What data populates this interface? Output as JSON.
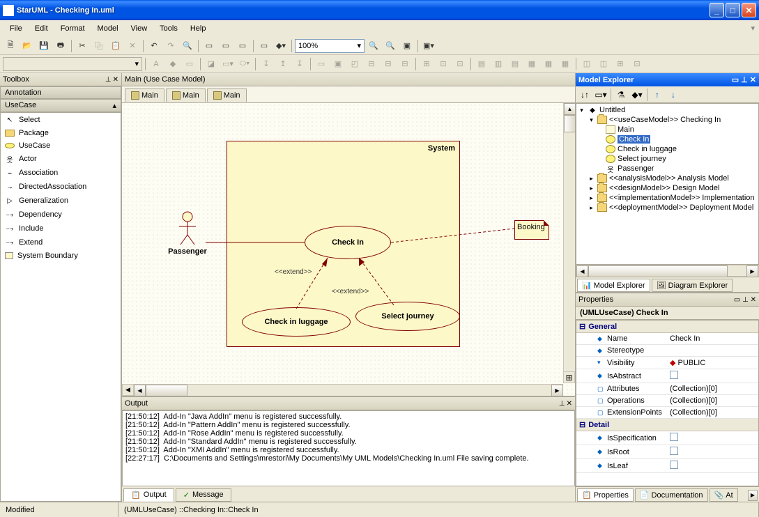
{
  "window": {
    "title": "StarUML - Checking In.uml"
  },
  "menu": [
    "File",
    "Edit",
    "Format",
    "Model",
    "View",
    "Tools",
    "Help"
  ],
  "zoom": "100%",
  "toolbox": {
    "title": "Toolbox",
    "section1": "Annotation",
    "section2": "UseCase",
    "items": [
      "Select",
      "Package",
      "UseCase",
      "Actor",
      "Association",
      "DirectedAssociation",
      "Generalization",
      "Dependency",
      "Include",
      "Extend",
      "System Boundary"
    ]
  },
  "diagram": {
    "header": "Main (Use Case Model)",
    "tabs": [
      "Main",
      "Main",
      "Main"
    ],
    "system_label": "System",
    "actor_label": "Passenger",
    "uc_checkin": "Check In",
    "uc_luggage": "Check in luggage",
    "uc_journey": "Select journey",
    "note": "Booking",
    "extend1": "<<extend>>",
    "extend2": "<<extend>>"
  },
  "output": {
    "title": "Output",
    "lines": "[21:50:12]  Add-In \"Java AddIn\" menu is registered successfully.\n[21:50:12]  Add-In \"Pattern AddIn\" menu is registered successfully.\n[21:50:12]  Add-In \"Rose AddIn\" menu is registered successfully.\n[21:50:12]  Add-In \"Standard AddIn\" menu is registered successfully.\n[21:50:12]  Add-In \"XMI AddIn\" menu is registered successfully.\n[22:27:17]  C:\\Documents and Settings\\mrestori\\My Documents\\My UML Models\\Checking In.uml File saving complete.",
    "tabs": [
      "Output",
      "Message"
    ]
  },
  "explorer": {
    "title": "Model Explorer",
    "root": "Untitled",
    "nodes": {
      "usecase_model": "<<useCaseModel>> Checking In",
      "main": "Main",
      "checkin": "Check In",
      "luggage": "Check in luggage",
      "journey": "Select journey",
      "passenger": "Passenger",
      "analysis": "<<analysisModel>> Analysis Model",
      "design": "<<designModel>> Design Model",
      "impl": "<<implementationModel>> Implementation ",
      "deploy": "<<deploymentModel>> Deployment Model"
    },
    "tabs": [
      "Model Explorer",
      "Diagram Explorer"
    ]
  },
  "properties": {
    "title": "Properties",
    "selected": "(UMLUseCase) Check In",
    "groups": {
      "general": "General",
      "detail": "Detail"
    },
    "rows": {
      "name": {
        "label": "Name",
        "value": "Check In"
      },
      "stereotype": {
        "label": "Stereotype",
        "value": ""
      },
      "visibility": {
        "label": "Visibility",
        "value": "PUBLIC"
      },
      "isabstract": {
        "label": "IsAbstract",
        "value": ""
      },
      "attributes": {
        "label": "Attributes",
        "value": "(Collection)[0]"
      },
      "operations": {
        "label": "Operations",
        "value": "(Collection)[0]"
      },
      "extpoints": {
        "label": "ExtensionPoints",
        "value": "(Collection)[0]"
      },
      "isspec": {
        "label": "IsSpecification",
        "value": ""
      },
      "isroot": {
        "label": "IsRoot",
        "value": ""
      },
      "isleaf": {
        "label": "IsLeaf",
        "value": ""
      }
    },
    "tabs": [
      "Properties",
      "Documentation",
      "At"
    ]
  },
  "status": {
    "modified": "Modified",
    "element": "(UMLUseCase) ::Checking In::Check In"
  }
}
